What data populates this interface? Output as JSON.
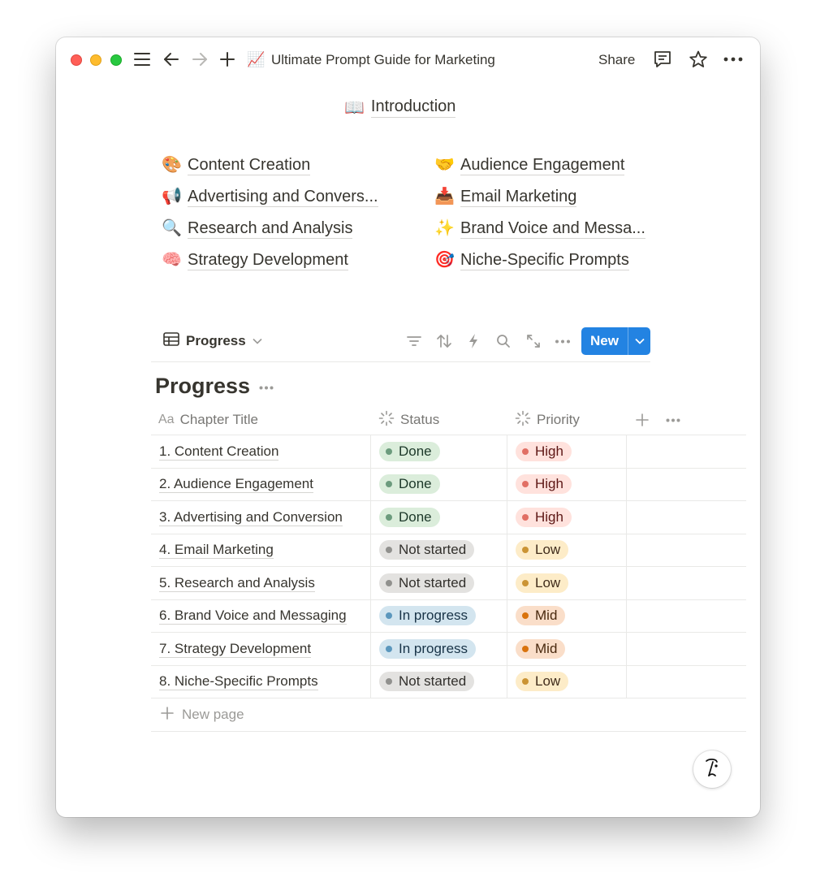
{
  "window": {
    "title_emoji": "📈",
    "title": "Ultimate Prompt Guide for Marketing",
    "share_label": "Share"
  },
  "intro": {
    "emoji": "📖",
    "label": "Introduction"
  },
  "links": [
    {
      "emoji": "🎨",
      "label": "Content Creation"
    },
    {
      "emoji": "🤝",
      "label": "Audience Engagement"
    },
    {
      "emoji": "📢",
      "label": "Advertising and Convers..."
    },
    {
      "emoji": "📥",
      "label": "Email Marketing"
    },
    {
      "emoji": "🔍",
      "label": "Research and Analysis"
    },
    {
      "emoji": "✨",
      "label": "Brand Voice and Messa..."
    },
    {
      "emoji": "🧠",
      "label": "Strategy Development"
    },
    {
      "emoji": "🎯",
      "label": "Niche-Specific Prompts"
    }
  ],
  "database": {
    "view_label": "Progress",
    "title": "Progress",
    "new_label": "New",
    "columns": {
      "title": "Chapter Title",
      "title_prefix": "Aa",
      "status": "Status",
      "priority": "Priority"
    },
    "rows": [
      {
        "title": "1. Content Creation",
        "status": "Done",
        "priority": "High"
      },
      {
        "title": "2. Audience Engagement",
        "status": "Done",
        "priority": "High"
      },
      {
        "title": "3. Advertising and Conversion",
        "status": "Done",
        "priority": "High"
      },
      {
        "title": "4. Email Marketing",
        "status": "Not started",
        "priority": "Low"
      },
      {
        "title": "5. Research and Analysis",
        "status": "Not started",
        "priority": "Low"
      },
      {
        "title": "6. Brand Voice and Messaging",
        "status": "In progress",
        "priority": "Mid"
      },
      {
        "title": "7. Strategy Development",
        "status": "In progress",
        "priority": "Mid"
      },
      {
        "title": "8. Niche-Specific Prompts",
        "status": "Not started",
        "priority": "Low"
      }
    ],
    "new_page_label": "New page"
  },
  "colors": {
    "accent": "#2383e2",
    "status": {
      "Done": {
        "bg": "#dbeddb",
        "dot": "#6c9b7d",
        "text": "#1c3829"
      },
      "Not started": {
        "bg": "#e3e2e0",
        "dot": "#91918e",
        "text": "#32302c"
      },
      "In progress": {
        "bg": "#d3e5ef",
        "dot": "#5b97bd",
        "text": "#183347"
      }
    },
    "priority": {
      "High": {
        "bg": "#ffe2dd",
        "dot": "#e16f64",
        "text": "#5d1715"
      },
      "Low": {
        "bg": "#fdecc8",
        "dot": "#cb9434",
        "text": "#402c1b"
      },
      "Mid": {
        "bg": "#fadec9",
        "dot": "#d9730d",
        "text": "#49290e"
      }
    }
  },
  "icons": [
    "sidebar-menu-icon",
    "back-arrow-icon",
    "forward-arrow-icon",
    "plus-icon",
    "comment-icon",
    "star-icon",
    "more-icon",
    "table-icon",
    "filter-icon",
    "sort-icon",
    "lightning-icon",
    "search-icon",
    "expand-icon",
    "help-icon"
  ]
}
